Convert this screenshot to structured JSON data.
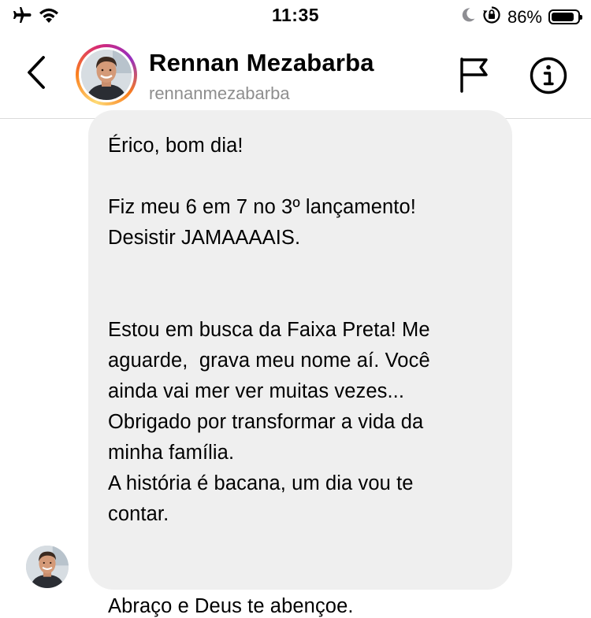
{
  "status_bar": {
    "time": "11:35",
    "battery_percent": "86%",
    "battery_level": 0.86,
    "icons": [
      "airplane-icon",
      "wifi-icon",
      "moon-icon",
      "orientation-lock-icon",
      "battery-icon"
    ]
  },
  "header": {
    "name": "Rennan Mezabarba",
    "username": "rennanmezabarba",
    "icons": [
      "back-chevron-icon",
      "flag-icon",
      "info-icon"
    ],
    "story_ring_colors": [
      "#feda75",
      "#fa7e1e",
      "#d62976",
      "#962fbf"
    ]
  },
  "message": {
    "text": "Érico, bom dia!\n\nFiz meu 6 em 7 no 3º lançamento!\nDesistir JAMAAAAIS.\n\n\nEstou em busca da Faixa Preta! Me\naguarde,  grava meu nome aí. Você\nainda vai mer ver muitas vezes...\nObrigado por transformar a vida da\nminha família.\nA história é bacana, um dia vou te\ncontar.\n\n\nAbraço e Deus te abençoe.",
    "bubble_color": "#efefef"
  }
}
